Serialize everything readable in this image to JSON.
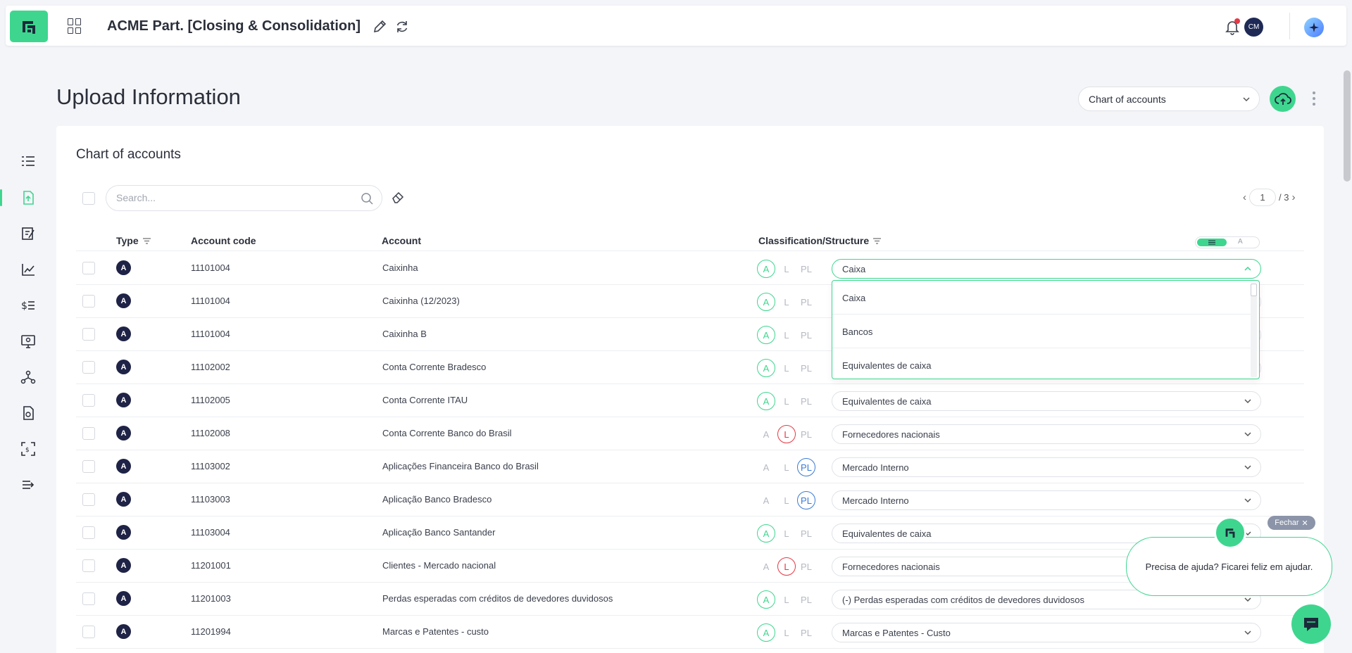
{
  "app": {
    "title": "ACME Part. [Closing & Consolidation]",
    "avatar_initials": "CM"
  },
  "page": {
    "title": "Upload Information",
    "selector_value": "Chart of accounts"
  },
  "card": {
    "title": "Chart of accounts",
    "search_placeholder": "Search...",
    "pager": {
      "current": "1",
      "total": "/ 3"
    }
  },
  "table": {
    "headers": {
      "type": "Type",
      "code": "Account code",
      "account": "Account",
      "classification": "Classification/Structure"
    },
    "toggle_off_label": "A",
    "rows": [
      {
        "type": "A",
        "code": "11101004",
        "account": "Caixinha",
        "class": "A",
        "structure": "Caixa"
      },
      {
        "type": "A",
        "code": "11101004",
        "account": "Caixinha (12/2023)",
        "class": "A",
        "structure": ""
      },
      {
        "type": "A",
        "code": "11101004",
        "account": "Caixinha B",
        "class": "A",
        "structure": ""
      },
      {
        "type": "A",
        "code": "11102002",
        "account": "Conta Corrente Bradesco",
        "class": "A",
        "structure": ""
      },
      {
        "type": "A",
        "code": "11102005",
        "account": "Conta Corrente ITAU",
        "class": "A",
        "structure": "Equivalentes de caixa"
      },
      {
        "type": "A",
        "code": "11102008",
        "account": "Conta Corrente Banco do Brasil",
        "class": "L",
        "structure": "Fornecedores nacionais"
      },
      {
        "type": "A",
        "code": "11103002",
        "account": "Aplicações Financeira Banco do Brasil",
        "class": "PL",
        "structure": "Mercado Interno"
      },
      {
        "type": "A",
        "code": "11103003",
        "account": "Aplicação Banco Bradesco",
        "class": "PL",
        "structure": "Mercado Interno"
      },
      {
        "type": "A",
        "code": "11103004",
        "account": "Aplicação Banco Santander",
        "class": "A",
        "structure": "Equivalentes de caixa"
      },
      {
        "type": "A",
        "code": "11201001",
        "account": "Clientes - Mercado nacional",
        "class": "L",
        "structure": "Fornecedores nacionais"
      },
      {
        "type": "A",
        "code": "11201003",
        "account": "Perdas esperadas com créditos de devedores duvidosos",
        "class": "A",
        "structure": "(-) Perdas esperadas com créditos de devedores duvidosos"
      },
      {
        "type": "A",
        "code": "11201994",
        "account": "Marcas e Patentes - custo",
        "class": "A",
        "structure": "Marcas e Patentes - Custo"
      }
    ],
    "class_labels": {
      "A": "A",
      "L": "L",
      "PL": "PL"
    }
  },
  "dropdown": {
    "options": [
      "Caixa",
      "Bancos",
      "Equivalentes de caixa"
    ]
  },
  "help": {
    "close_label": "Fechar",
    "message": "Precisa de ajuda? Ficarei feliz em ajudar."
  },
  "colors": {
    "accent": "#3ed68f",
    "liability": "#e53945",
    "equity": "#3a7bd5",
    "badge": "#1f2346"
  }
}
